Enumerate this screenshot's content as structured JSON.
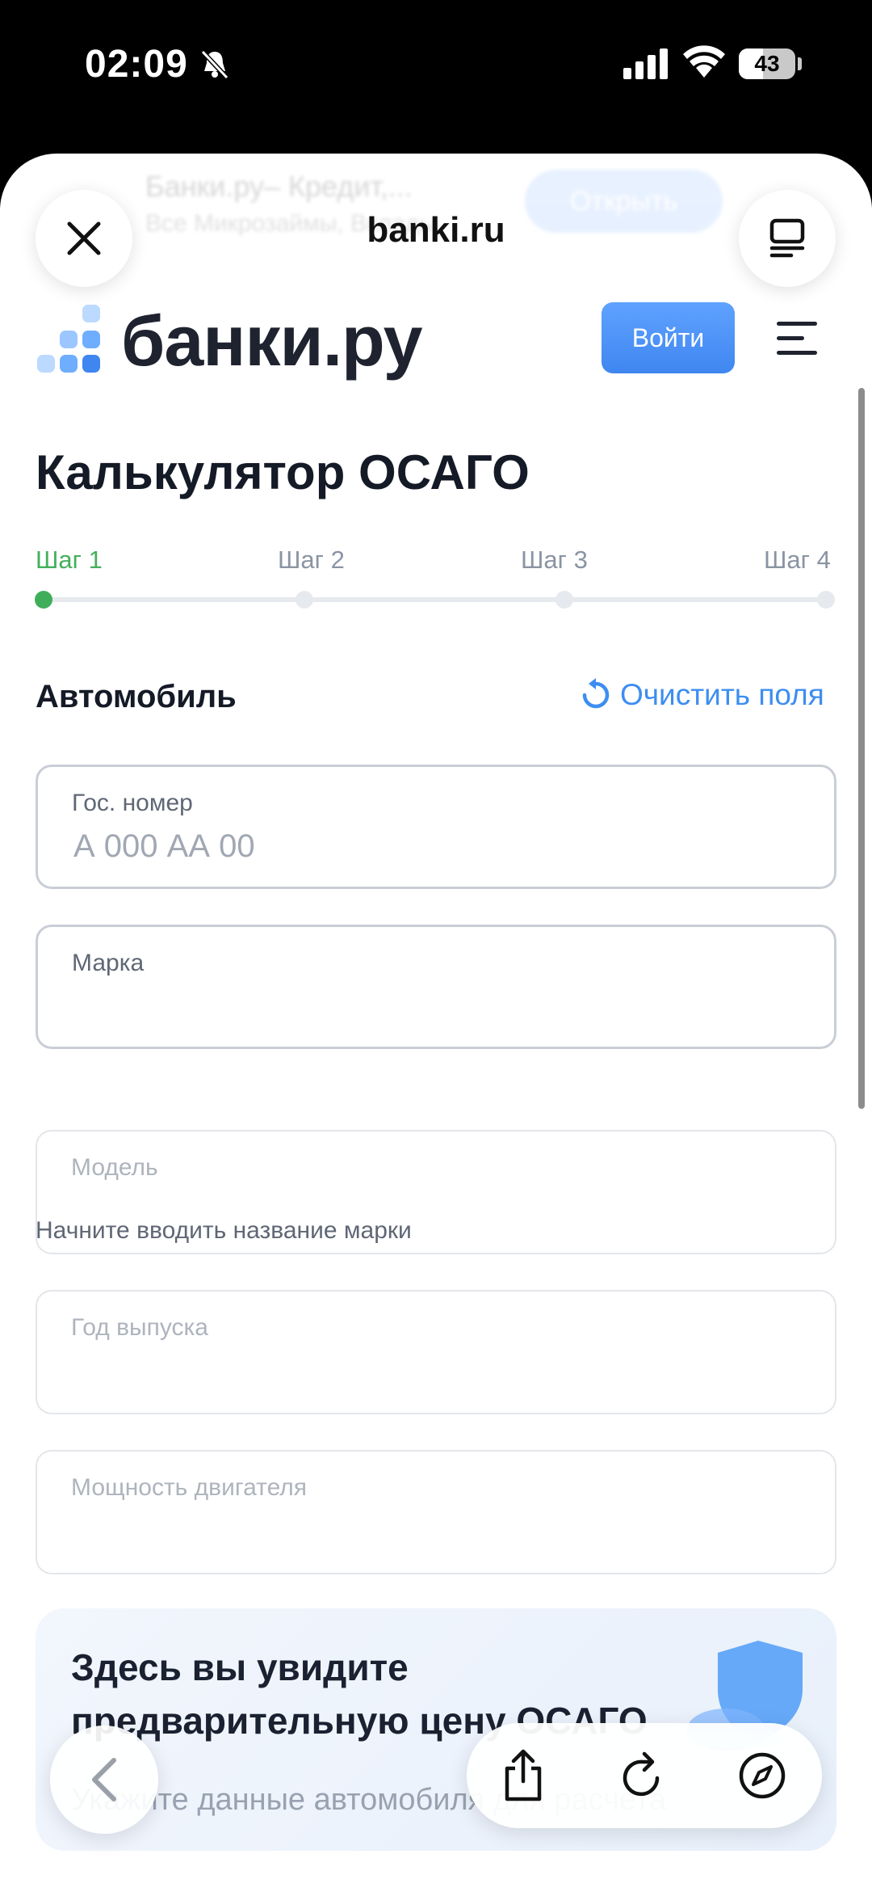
{
  "status_bar": {
    "time": "02:09",
    "battery": "43",
    "battery_level": 0.43
  },
  "browser": {
    "domain": "banki.ru",
    "app_banner": {
      "title": "Банки.ру– Кредит,...",
      "subtitle": "Все Микрозаймы, Вклады",
      "open_label": "Открыть"
    }
  },
  "site": {
    "logo_text": "банки.ру",
    "login_label": "Войти"
  },
  "page": {
    "title": "Калькулятор ОСАГО"
  },
  "stepper": {
    "steps": [
      "Шаг 1",
      "Шаг 2",
      "Шаг 3",
      "Шаг 4"
    ],
    "active_step": 1,
    "accent": "#3fae5a"
  },
  "form": {
    "section_title": "Автомобиль",
    "clear_label": "Очистить поля",
    "plate": {
      "label": "Гос. номер",
      "placeholder": "А 000 АА 00"
    },
    "brand": {
      "label": "Марка",
      "value": ""
    },
    "brand_hint": "Начните вводить название марки",
    "model": {
      "label": "Модель"
    },
    "year": {
      "label": "Год выпуска"
    },
    "power": {
      "label": "Мощность двигателя"
    }
  },
  "info_card": {
    "title": "Здесь вы увидите предварительную цену ОСАГО",
    "subtitle": "Укажите данные автомобиля для расчета"
  },
  "colors": {
    "primary": "#3d8ef0",
    "green": "#3fae5a",
    "text": "#141a26"
  },
  "toolbar": {
    "icons": [
      "back-icon",
      "share-icon",
      "reload-icon",
      "compass-icon"
    ]
  }
}
